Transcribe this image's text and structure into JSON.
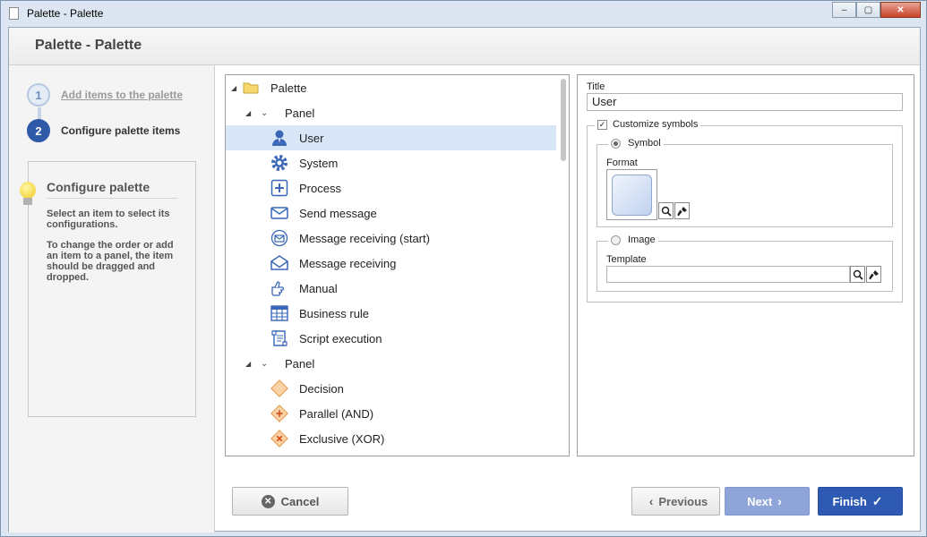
{
  "window": {
    "title": "Palette - Palette",
    "buttons": {
      "minimize": "‒",
      "maximize": "▢",
      "close": "✕"
    }
  },
  "header": {
    "title": "Palette - Palette"
  },
  "wizard": {
    "steps": [
      {
        "number": "1",
        "label": "Add items to the palette"
      },
      {
        "number": "2",
        "label": "Configure palette items"
      }
    ]
  },
  "info": {
    "title": "Configure palette",
    "p1": "Select an item to select its configurations.",
    "p2": "To change the order or add an item to a panel, the item should be dragged and dropped."
  },
  "tree": {
    "root": "Palette",
    "panels": [
      {
        "label": "Panel",
        "items": [
          {
            "label": "User",
            "icon": "user-icon"
          },
          {
            "label": "System",
            "icon": "gear-icon"
          },
          {
            "label": "Process",
            "icon": "plus-box-icon"
          },
          {
            "label": "Send message",
            "icon": "envelope-icon"
          },
          {
            "label": "Message receiving (start)",
            "icon": "envelope-circle-icon"
          },
          {
            "label": "Message receiving",
            "icon": "open-envelope-icon"
          },
          {
            "label": "Manual",
            "icon": "hand-icon"
          },
          {
            "label": "Business rule",
            "icon": "table-icon"
          },
          {
            "label": "Script execution",
            "icon": "scroll-icon"
          }
        ]
      },
      {
        "label": "Panel",
        "items": [
          {
            "label": "Decision",
            "icon": "diamond-icon"
          },
          {
            "label": "Parallel (AND)",
            "icon": "diamond-plus-icon"
          },
          {
            "label": "Exclusive (XOR)",
            "icon": "diamond-x-icon"
          }
        ]
      }
    ],
    "selected": "User"
  },
  "props": {
    "title_label": "Title",
    "title_value": "User",
    "customize_label": "Customize symbols",
    "symbol_label": "Symbol",
    "format_label": "Format",
    "image_label": "Image",
    "template_label": "Template"
  },
  "footer": {
    "cancel": "Cancel",
    "previous": "Previous",
    "next": "Next",
    "finish": "Finish"
  },
  "colors": {
    "accent": "#2e5ab3",
    "selection": "#d8e6f8",
    "icon_blue": "#3a67b8",
    "icon_orange": "#f0a050"
  }
}
